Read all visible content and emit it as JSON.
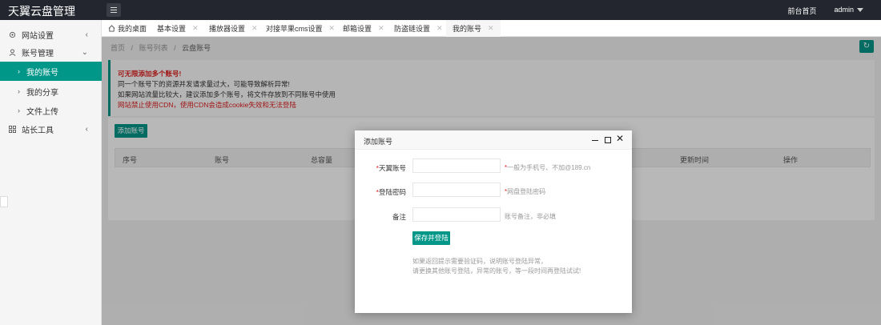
{
  "header": {
    "logo": "天翼云盘管理",
    "home_link": "前台首页",
    "user": "admin"
  },
  "sidebar": {
    "items": [
      {
        "label": "网站设置",
        "arrow": "‹"
      },
      {
        "label": "账号管理",
        "arrow": "⌄"
      },
      {
        "label": "站长工具",
        "arrow": "‹"
      }
    ],
    "sub_items": [
      {
        "label": "我的账号"
      },
      {
        "label": "我的分享"
      },
      {
        "label": "文件上传"
      }
    ]
  },
  "tabs": [
    {
      "label": "我的桌面"
    },
    {
      "label": "基本设置"
    },
    {
      "label": "播放器设置"
    },
    {
      "label": "对接苹果cms设置"
    },
    {
      "label": "邮箱设置"
    },
    {
      "label": "防盗链设置"
    },
    {
      "label": "我的账号"
    }
  ],
  "breadcrumb": {
    "home": "首页",
    "list": "账号列表",
    "current": "云盘账号",
    "sep": "/"
  },
  "notice": {
    "title": "可无限添加多个账号!",
    "line1": "同一个账号下的资源并发请求量过大，可能导致解析异常!",
    "line2": "如果网站流量比较大，建议添加多个账号，将文件存放到不同账号中使用",
    "line3": "网站禁止使用CDN，使用CDN会造成cookie失效和无法登陆"
  },
  "panel": {
    "add_button": "添加账号",
    "columns": [
      "序号",
      "账号",
      "总容量",
      "更新时间",
      "操作"
    ]
  },
  "modal": {
    "title": "添加账号",
    "fields": [
      {
        "label": "天翼账号",
        "required": "*",
        "value": "",
        "hint": "一般为手机号、不加@189.cn",
        "hint_req": "*"
      },
      {
        "label": "登陆密码",
        "required": "*",
        "value": "",
        "hint": "网盘登陆密码",
        "hint_req": "*"
      },
      {
        "label": "备注",
        "required": "",
        "value": "",
        "hint": "账号备注，非必填",
        "hint_req": ""
      }
    ],
    "save_button": "保存并登陆",
    "note_line1": "如果返回提示需要验证码，说明账号登陆异常，",
    "note_line2": "请更换其他账号登陆，异常的账号，等一段时间再登陆试试!"
  },
  "colors": {
    "accent": "#009688",
    "header_bg": "#23262e",
    "warning": "#e02020"
  }
}
